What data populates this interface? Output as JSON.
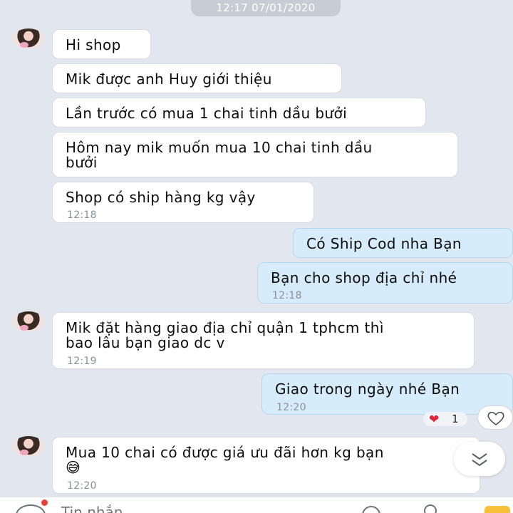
{
  "header": {
    "timestamp": "12:17 07/01/2020"
  },
  "messages": [
    {
      "direction": "in",
      "text": "Hi shop",
      "time": ""
    },
    {
      "direction": "in",
      "text": "Mik được anh Huy giới thiệu",
      "time": ""
    },
    {
      "direction": "in",
      "text": "Lần trước có mua 1 chai tinh dầu bưởi",
      "time": ""
    },
    {
      "direction": "in",
      "text": "Hôm nay mik muốn mua 10 chai tinh dầu\nbưởi",
      "time": ""
    },
    {
      "direction": "in",
      "text": "Shop có ship hàng kg vậy",
      "time": "12:18"
    },
    {
      "direction": "out",
      "text": "Có Ship Cod nha Bạn",
      "time": ""
    },
    {
      "direction": "out",
      "text": "Bạn cho shop địa chỉ nhé",
      "time": "12:18"
    },
    {
      "direction": "in",
      "text": "Mik đặt hàng giao địa chỉ quận 1 tphcm thì\nbao lâu bạn giao dc v",
      "time": "12:19"
    },
    {
      "direction": "out",
      "text": "Giao trong ngày nhé Bạn",
      "time": "12:20"
    },
    {
      "direction": "in",
      "text": "Mua 10 chai có được giá ưu đãi hơn kg bạn\n😅",
      "time": "12:20"
    }
  ],
  "reaction": {
    "icon": "heart-icon",
    "count": "1"
  },
  "composer": {
    "placeholder": "Tin nhắn"
  },
  "colors": {
    "background": "#e2e6ee",
    "incoming_bubble": "#ffffff",
    "outgoing_bubble": "#d7ecfb",
    "heart": "#e0243e"
  }
}
